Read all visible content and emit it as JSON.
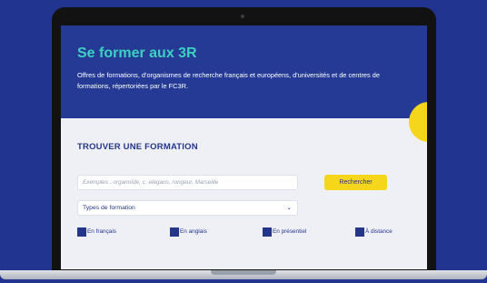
{
  "hero": {
    "title": "Se former aux 3R",
    "description": "Offres de formations, d'organismes de recherche français et européens, d'universités et de centres de formations, répertoriées par le FC3R."
  },
  "search": {
    "section_title": "TROUVER UNE FORMATION",
    "placeholder": "Exemples : organoïde, c. elegans, rongeur, Marseille",
    "button_label": "Rechercher",
    "type_select": "Types de formation"
  },
  "filters": [
    "En français",
    "En anglais",
    "En présentiel",
    "À distance"
  ],
  "colors": {
    "background": "#213590",
    "hero": "#243a94",
    "title_accent": "#3dd1c1",
    "button": "#f6d61b",
    "text_primary": "#25358a"
  }
}
